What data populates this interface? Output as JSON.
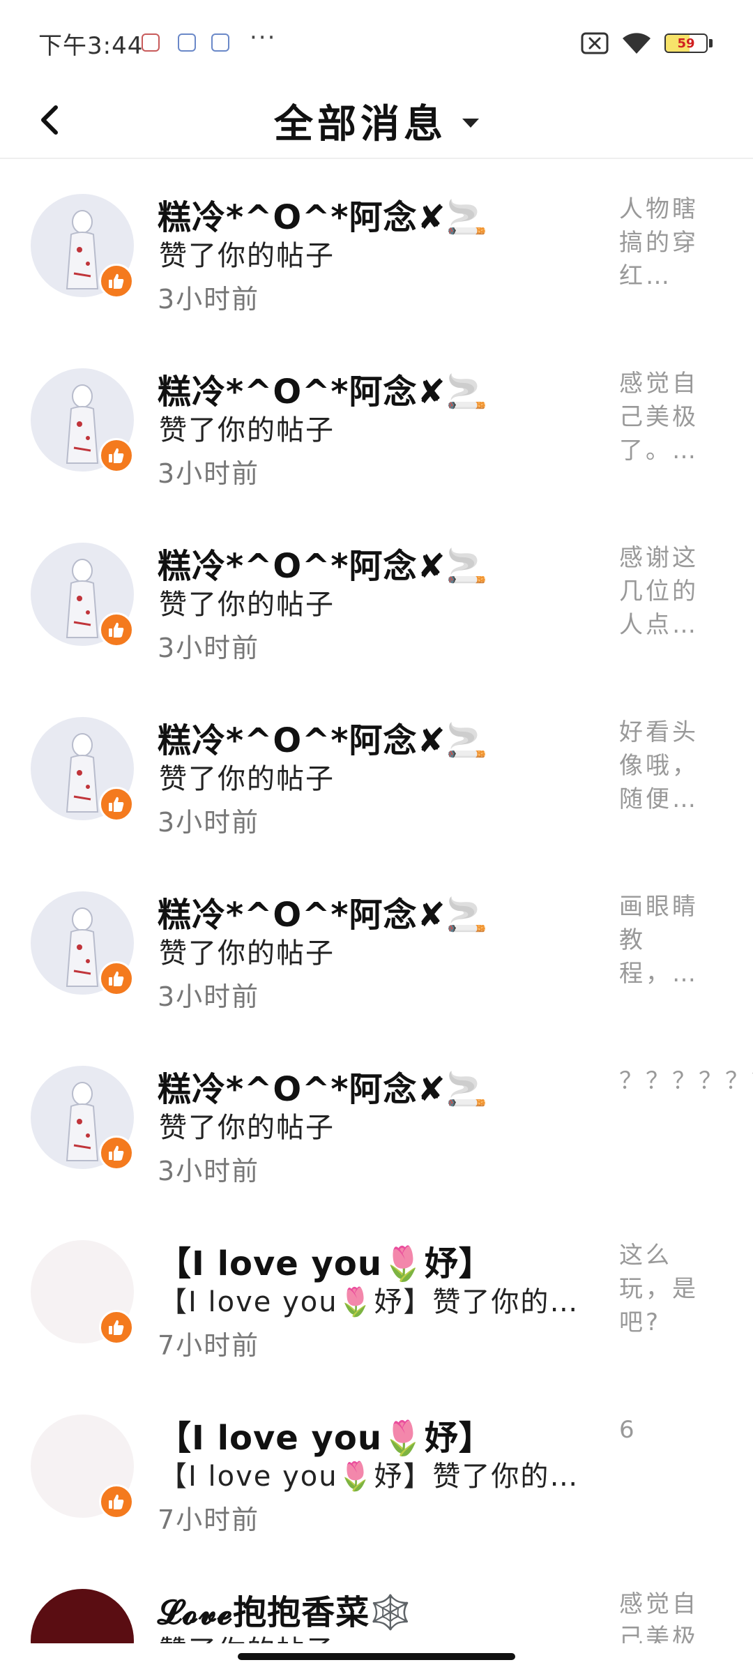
{
  "status_bar": {
    "time": "下午3:44",
    "more_dots": "···",
    "battery_level": "59",
    "battery_fraction": 0.59,
    "battery_fill_color": "#f7e36a",
    "icons": [
      "app-icon-1",
      "app-icon-2",
      "app-icon-3",
      "no-sim-icon",
      "wifi-icon",
      "battery-icon"
    ]
  },
  "header": {
    "title": "全部消息",
    "back_icon": "chevron-left-icon",
    "dropdown_icon": "caret-down-icon"
  },
  "messages": [
    {
      "name": "糕冷*^O^*阿念✘🚬",
      "action": "赞了你的帖子",
      "time": "3小时前",
      "preview": "人物瞎搞的穿红…",
      "avatar_style": "a",
      "badge_icon": "thumbs-up-icon"
    },
    {
      "name": "糕冷*^O^*阿念✘🚬",
      "action": "赞了你的帖子",
      "time": "3小时前",
      "preview": "感觉自己美极了。…",
      "avatar_style": "a",
      "badge_icon": "thumbs-up-icon"
    },
    {
      "name": "糕冷*^O^*阿念✘🚬",
      "action": "赞了你的帖子",
      "time": "3小时前",
      "preview": "感谢这几位的人点…",
      "avatar_style": "a",
      "badge_icon": "thumbs-up-icon"
    },
    {
      "name": "糕冷*^O^*阿念✘🚬",
      "action": "赞了你的帖子",
      "time": "3小时前",
      "preview": "好看头像哦，随便…",
      "avatar_style": "a",
      "badge_icon": "thumbs-up-icon"
    },
    {
      "name": "糕冷*^O^*阿念✘🚬",
      "action": "赞了你的帖子",
      "time": "3小时前",
      "preview": "画眼睛教程，…",
      "avatar_style": "a",
      "badge_icon": "thumbs-up-icon"
    },
    {
      "name": "糕冷*^O^*阿念✘🚬",
      "action": "赞了你的帖子",
      "time": "3小时前",
      "preview": "？？？？？？？？…",
      "avatar_style": "a",
      "badge_icon": "thumbs-up-icon"
    },
    {
      "name": "【I love you🌷妤】",
      "action": "【I love you🌷妤】赞了你的…",
      "time": "7小时前",
      "preview": "这么玩，是吧?",
      "avatar_style": "b",
      "badge_icon": "thumbs-up-icon"
    },
    {
      "name": "【I love you🌷妤】",
      "action": "【I love you🌷妤】赞了你的…",
      "time": "7小时前",
      "preview": "6",
      "avatar_style": "b",
      "badge_icon": "thumbs-up-icon"
    },
    {
      "name": "𝓛𝓸𝓿𝓮抱抱香菜🕸️",
      "action": "赞了你的帖子",
      "time": "",
      "preview": "感觉自己美极",
      "avatar_style": "c",
      "badge_icon": "thumbs-up-icon"
    }
  ]
}
